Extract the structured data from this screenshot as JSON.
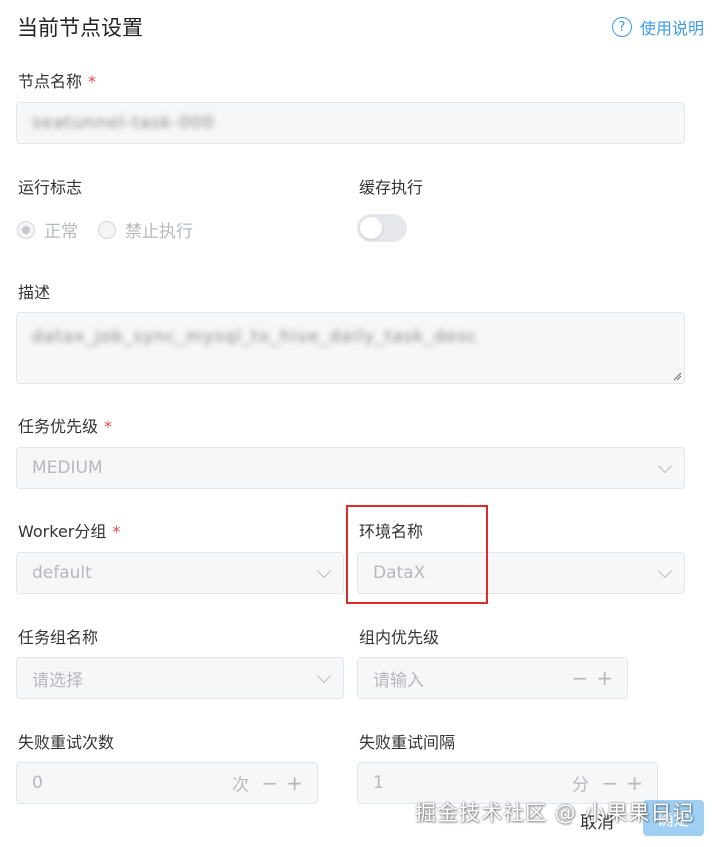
{
  "header": {
    "title": "当前节点设置",
    "help_label": "使用说明",
    "help_icon": "?"
  },
  "fields": {
    "node_name": {
      "label": "节点名称",
      "required": "*",
      "value": "seatunnel-task-000"
    },
    "run_flag": {
      "label": "运行标志",
      "options": [
        "正常",
        "禁止执行"
      ],
      "selected": "正常"
    },
    "cache_exec": {
      "label": "缓存执行",
      "enabled": false
    },
    "description": {
      "label": "描述",
      "value": "datax_job_sync_mysql_to_hive_daily_task_desc"
    },
    "priority": {
      "label": "任务优先级",
      "required": "*",
      "value": "MEDIUM"
    },
    "worker_group": {
      "label": "Worker分组",
      "required": "*",
      "value": "default"
    },
    "environment": {
      "label": "环境名称",
      "value": "DataX"
    },
    "task_group": {
      "label": "任务组名称",
      "placeholder": "请选择"
    },
    "group_priority": {
      "label": "组内优先级",
      "placeholder": "请输入",
      "minus": "−",
      "plus": "+"
    },
    "retry_times": {
      "label": "失败重试次数",
      "value": "0",
      "unit": "次",
      "minus": "−",
      "plus": "+"
    },
    "retry_interval": {
      "label": "失败重试间隔",
      "value": "1",
      "unit": "分",
      "minus": "−",
      "plus": "+"
    }
  },
  "footer": {
    "cancel_label": "取消",
    "confirm_label": "确定"
  },
  "watermark": "掘金技术社区 @ 小果果日记",
  "colors": {
    "accent": "#3d9be9",
    "required": "#e64c4c",
    "highlight": "#e02a2a"
  }
}
